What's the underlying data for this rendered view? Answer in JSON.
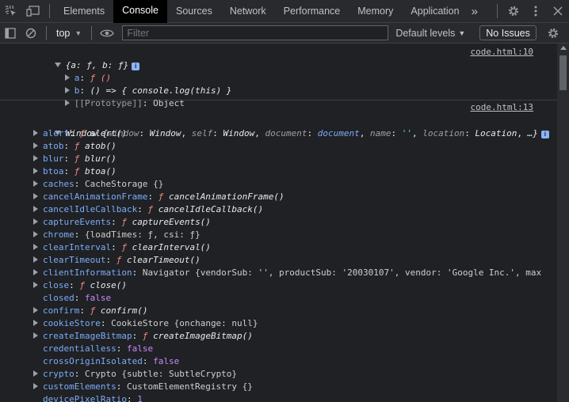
{
  "tabs": [
    "Elements",
    "Console",
    "Sources",
    "Network",
    "Performance",
    "Memory",
    "Application"
  ],
  "more_tabs": "»",
  "toolbar": {
    "context": "top",
    "filter_placeholder": "Filter",
    "levels": "Default levels",
    "issues": "No Issues"
  },
  "msg1": {
    "source": "code.html:10",
    "summary": "{a: ƒ, b: ƒ}",
    "a_key": "a",
    "a_val": "ƒ ()",
    "b_key": "b",
    "b_val": "() => { console.log(this) }",
    "proto_key": "[[Prototype]]",
    "proto_val": "Object"
  },
  "msg2": {
    "source": "code.html:13",
    "summary_head": "Window {",
    "summary_items": [
      {
        "k": "window",
        "v": "Window",
        "t": "plain"
      },
      {
        "k": "self",
        "v": "Window",
        "t": "plain"
      },
      {
        "k": "document",
        "v": "document",
        "t": "link"
      },
      {
        "k": "name",
        "v": "''",
        "t": "str"
      },
      {
        "k": "location",
        "v": "Location",
        "t": "plain"
      }
    ],
    "summary_tail": "…}",
    "rows": [
      {
        "k": "alert",
        "expand": true,
        "f": "ƒ",
        "v": "alert()",
        "t": "fn"
      },
      {
        "k": "atob",
        "expand": true,
        "f": "ƒ",
        "v": "atob()",
        "t": "fn"
      },
      {
        "k": "blur",
        "expand": true,
        "f": "ƒ",
        "v": "blur()",
        "t": "fn"
      },
      {
        "k": "btoa",
        "expand": true,
        "f": "ƒ",
        "v": "btoa()",
        "t": "fn"
      },
      {
        "k": "caches",
        "expand": true,
        "v": "CacheStorage {}",
        "t": "cls"
      },
      {
        "k": "cancelAnimationFrame",
        "expand": true,
        "f": "ƒ",
        "v": "cancelAnimationFrame()",
        "t": "fn"
      },
      {
        "k": "cancelIdleCallback",
        "expand": true,
        "f": "ƒ",
        "v": "cancelIdleCallback()",
        "t": "fn"
      },
      {
        "k": "captureEvents",
        "expand": true,
        "f": "ƒ",
        "v": "captureEvents()",
        "t": "fn"
      },
      {
        "k": "chrome",
        "expand": true,
        "v": "{loadTimes: ƒ, csi: ƒ}",
        "t": "cls"
      },
      {
        "k": "clearInterval",
        "expand": true,
        "f": "ƒ",
        "v": "clearInterval()",
        "t": "fn"
      },
      {
        "k": "clearTimeout",
        "expand": true,
        "f": "ƒ",
        "v": "clearTimeout()",
        "t": "fn"
      },
      {
        "k": "clientInformation",
        "expand": true,
        "v": "Navigator {vendorSub: '', productSub: '20030107', vendor: 'Google Inc.', max",
        "t": "cls"
      },
      {
        "k": "close",
        "expand": true,
        "f": "ƒ",
        "v": "close()",
        "t": "fn"
      },
      {
        "k": "closed",
        "expand": false,
        "v": "false",
        "t": "kw"
      },
      {
        "k": "confirm",
        "expand": true,
        "f": "ƒ",
        "v": "confirm()",
        "t": "fn"
      },
      {
        "k": "cookieStore",
        "expand": true,
        "v": "CookieStore {onchange: null}",
        "t": "cls"
      },
      {
        "k": "createImageBitmap",
        "expand": true,
        "f": "ƒ",
        "v": "createImageBitmap()",
        "t": "fn"
      },
      {
        "k": "credentialless",
        "expand": false,
        "v": "false",
        "t": "kw"
      },
      {
        "k": "crossOriginIsolated",
        "expand": false,
        "v": "false",
        "t": "kw"
      },
      {
        "k": "crypto",
        "expand": true,
        "v": "Crypto {subtle: SubtleCrypto}",
        "t": "cls"
      },
      {
        "k": "customElements",
        "expand": true,
        "v": "CustomElementRegistry {}",
        "t": "cls"
      },
      {
        "k": "devicePixelRatio",
        "expand": false,
        "v": "1",
        "t": "num"
      }
    ]
  }
}
